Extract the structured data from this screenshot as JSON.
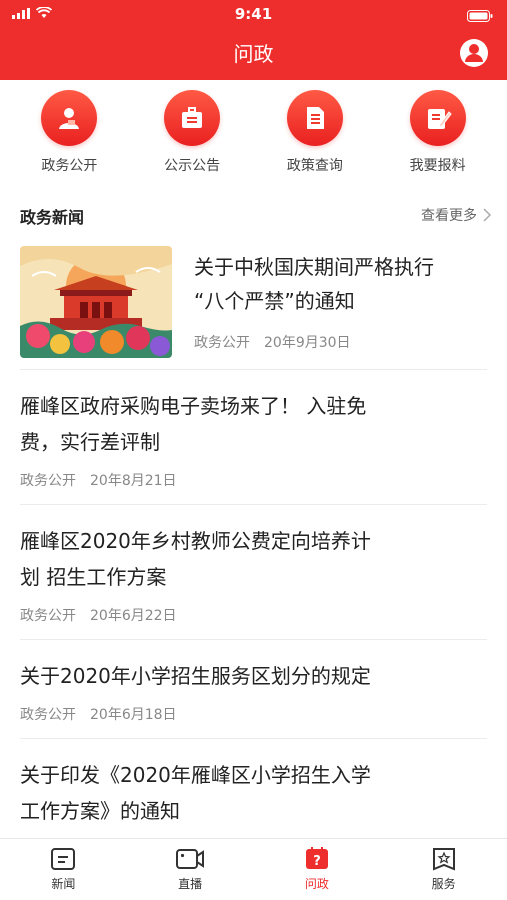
{
  "status_bar": {
    "time": "9:41"
  },
  "header": {
    "title": "问政",
    "user_icon": "user-circle-icon",
    "background": "#ee2d2d"
  },
  "quick_actions": [
    {
      "label": "政务公开",
      "icon": "person-doc-icon"
    },
    {
      "label": "公示公告",
      "icon": "bulletin-icon"
    },
    {
      "label": "政策查询",
      "icon": "document-icon"
    },
    {
      "label": "我要报料",
      "icon": "edit-report-icon"
    }
  ],
  "section": {
    "title": "政务新闻",
    "more": "查看更多"
  },
  "news": [
    {
      "title_line1": "关于中秋国庆期间严格执行",
      "title_line2": "“八个严禁”的通知",
      "source": "政务公开",
      "date": "20年9月30日"
    },
    {
      "title_line1": "雁峰区政府采购电子卖场来了！  入驻免",
      "title_line2": "费，实行差评制",
      "source": "政务公开",
      "date": "20年8月21日"
    },
    {
      "title_line1": "雁峰区2020年乡村教师公费定向培养计",
      "title_line2": "划 招生工作方案",
      "source": "政务公开",
      "date": "20年6月22日"
    },
    {
      "title_line1": "关于2020年小学招生服务区划分的规定",
      "source": "政务公开",
      "date": "20年6月18日"
    },
    {
      "title_line1": "关于印发《2020年雁峰区小学招生入学",
      "title_line2": "工作方案》的通知"
    }
  ],
  "tabs": [
    {
      "label": "新闻",
      "icon": "news-icon"
    },
    {
      "label": "直播",
      "icon": "camera-icon"
    },
    {
      "label": "问政",
      "icon": "question-icon",
      "active": true
    },
    {
      "label": "服务",
      "icon": "service-star-icon"
    }
  ],
  "colors": {
    "accent": "#ee2d2d",
    "meta": "#888888"
  }
}
